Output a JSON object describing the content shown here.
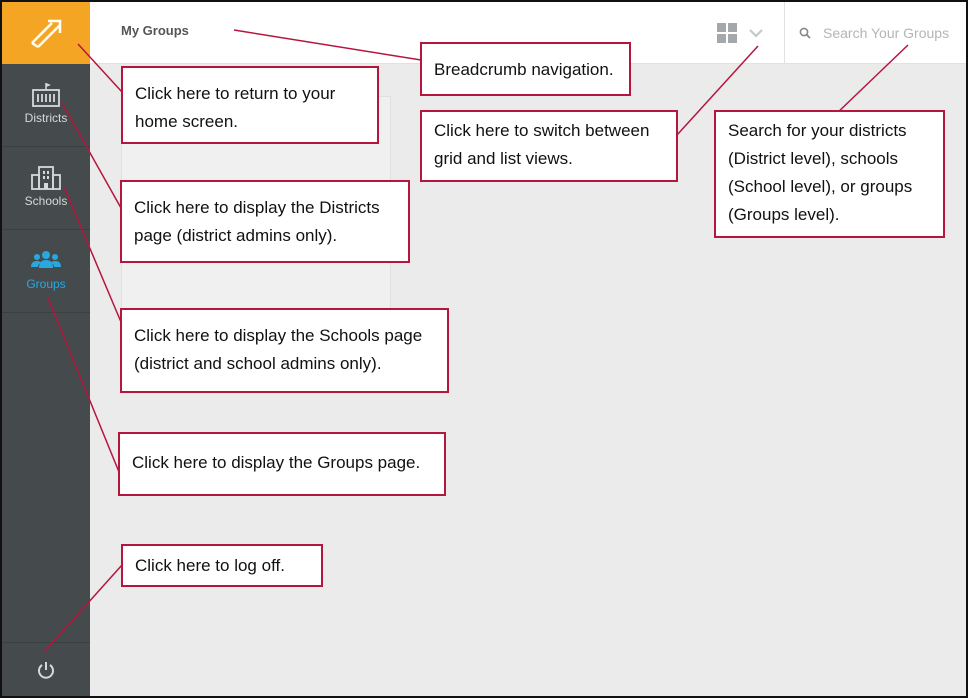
{
  "sidebar": {
    "items": [
      {
        "label": "Districts"
      },
      {
        "label": "Schools"
      },
      {
        "label": "Groups"
      }
    ]
  },
  "header": {
    "breadcrumb": "My Groups",
    "search_placeholder": "Search Your Groups"
  },
  "callouts": {
    "home": "Click here to return to your home screen.",
    "breadcrumb": "Breadcrumb navigation.",
    "view_toggle": "Click here to switch between grid and list views.",
    "search": "Search for your districts (District level), schools (School level), or groups (Groups level).",
    "districts": "Click here to display the Districts page (district admins only).",
    "schools": "Click here to display the Schools page (district and school admins only).",
    "groups": "Click here to display the Groups page.",
    "logoff": "Click here to log off."
  },
  "colors": {
    "accent_orange": "#f5a524",
    "active_blue": "#29a8e0",
    "callout_border": "#b5163d",
    "sidebar_bg": "#454b4d"
  }
}
